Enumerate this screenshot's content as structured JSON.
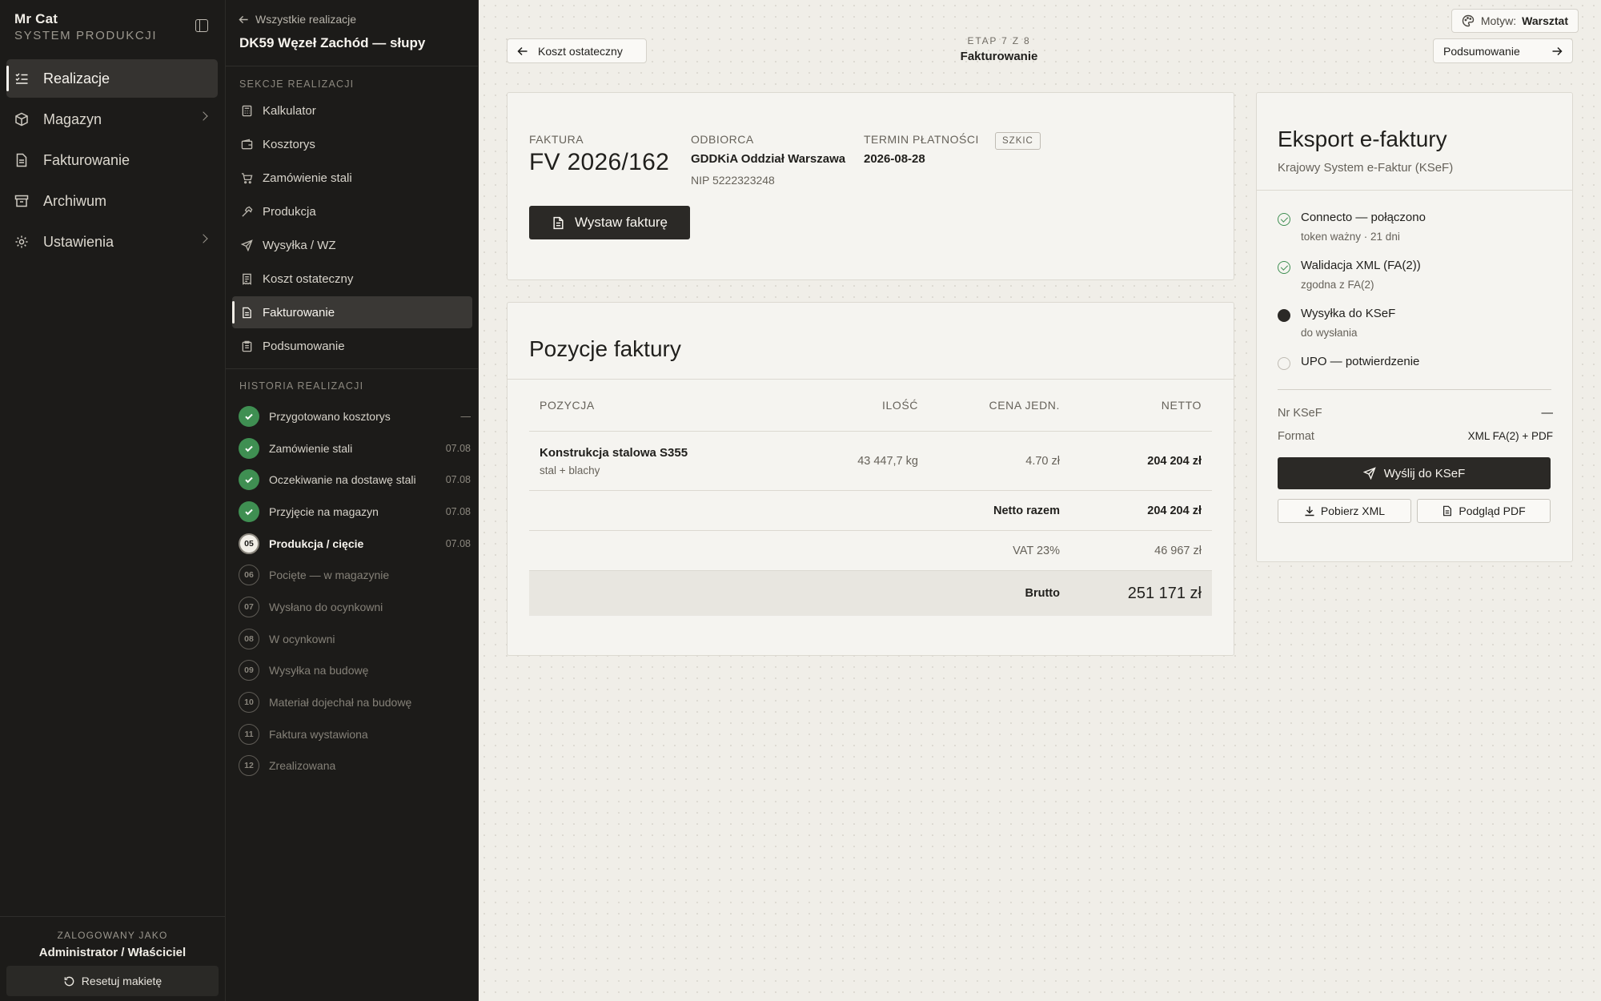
{
  "app": {
    "name": "Mr Cat",
    "subtitle": "SYSTEM PRODUKCJI"
  },
  "nav": [
    {
      "label": "Realizacje",
      "icon": "list-check-icon",
      "active": true
    },
    {
      "label": "Magazyn",
      "icon": "box-icon",
      "chevron": true
    },
    {
      "label": "Fakturowanie",
      "icon": "document-icon"
    },
    {
      "label": "Archiwum",
      "icon": "archive-icon"
    },
    {
      "label": "Ustawienia",
      "icon": "gear-icon",
      "chevron": true
    }
  ],
  "user": {
    "label": "ZALOGOWANY JAKO",
    "name": "Administrator / Właściciel",
    "reset_label": "Resetuj makietę"
  },
  "project": {
    "back_label": "Wszystkie realizacje",
    "title": "DK59 Węzeł Zachód — słupy",
    "sections_header": "SEKCJE REALIZACJI",
    "history_header": "HISTORIA REALIZACJI"
  },
  "sections": [
    {
      "label": "Kalkulator",
      "icon": "calculator-icon"
    },
    {
      "label": "Kosztorys",
      "icon": "wallet-icon"
    },
    {
      "label": "Zamówienie stali",
      "icon": "cart-icon"
    },
    {
      "label": "Produkcja",
      "icon": "hammer-icon"
    },
    {
      "label": "Wysyłka / WZ",
      "icon": "send-icon"
    },
    {
      "label": "Koszt ostateczny",
      "icon": "receipt-icon"
    },
    {
      "label": "Fakturowanie",
      "icon": "document-icon",
      "active": true
    },
    {
      "label": "Podsumowanie",
      "icon": "clipboard-icon"
    }
  ],
  "history": [
    {
      "num": "",
      "label": "Przygotowano kosztorys",
      "date": "—",
      "status": "done"
    },
    {
      "num": "",
      "label": "Zamówienie stali",
      "date": "07.08",
      "status": "done"
    },
    {
      "num": "",
      "label": "Oczekiwanie na dostawę stali",
      "date": "07.08",
      "status": "done"
    },
    {
      "num": "",
      "label": "Przyjęcie na magazyn",
      "date": "07.08",
      "status": "done"
    },
    {
      "num": "05",
      "label": "Produkcja / cięcie",
      "date": "07.08",
      "status": "current"
    },
    {
      "num": "06",
      "label": "Pocięte — w magazynie",
      "date": "",
      "status": "todo"
    },
    {
      "num": "07",
      "label": "Wysłano do ocynkowni",
      "date": "",
      "status": "todo"
    },
    {
      "num": "08",
      "label": "W ocynkowni",
      "date": "",
      "status": "todo"
    },
    {
      "num": "09",
      "label": "Wysyłka na budowę",
      "date": "",
      "status": "todo"
    },
    {
      "num": "10",
      "label": "Materiał dojechał na budowę",
      "date": "",
      "status": "todo"
    },
    {
      "num": "11",
      "label": "Faktura wystawiona",
      "date": "",
      "status": "todo"
    },
    {
      "num": "12",
      "label": "Zrealizowana",
      "date": "",
      "status": "todo"
    }
  ],
  "topbar": {
    "theme_label": "Motyw:",
    "theme_value": "Warsztat",
    "prev_label": "Koszt ostateczny",
    "next_label": "Podsumowanie",
    "step_label": "ETAP 7 Z 8",
    "step_title": "Fakturowanie"
  },
  "invoice": {
    "number_label": "FAKTURA",
    "number": "FV 2026/162",
    "recipient_label": "ODBIORCA",
    "recipient": "GDDKiA Oddział Warszawa",
    "nip": "NIP 5222323248",
    "due_label": "TERMIN PŁATNOŚCI",
    "due": "2026-08-28",
    "status": "SZKIC",
    "issue_button": "Wystaw fakturę"
  },
  "items": {
    "title": "Pozycje faktury",
    "headers": [
      "POZYCJA",
      "ILOŚĆ",
      "CENA JEDN.",
      "NETTO"
    ],
    "rows": [
      {
        "name": "Konstrukcja stalowa S355",
        "desc": "stal + blachy",
        "qty": "43 447,7 kg",
        "price": "4.70 zł",
        "net": "204 204 zł"
      }
    ],
    "net_total_label": "Netto razem",
    "net_total": "204 204 zł",
    "vat_label": "VAT 23%",
    "vat": "46 967 zł",
    "gross_label": "Brutto",
    "gross": "251 171 zł"
  },
  "ksef": {
    "title": "Eksport e-faktury",
    "subtitle": "Krajowy System e-Faktur (KSeF)",
    "steps": [
      {
        "title": "Connecto — połączono",
        "sub": "token ważny · 21 dni",
        "status": "ok"
      },
      {
        "title": "Walidacja XML (FA(2))",
        "sub": "zgodna z FA(2)",
        "status": "ok"
      },
      {
        "title": "Wysyłka do KSeF",
        "sub": "do wysłania",
        "status": "cur"
      },
      {
        "title": "UPO — potwierdzenie",
        "sub": "",
        "status": "todo"
      }
    ],
    "nr_label": "Nr KSeF",
    "nr_value": "—",
    "format_label": "Format",
    "format_value": "XML FA(2) + PDF",
    "send_button": "Wyślij do KSeF",
    "xml_button": "Pobierz XML",
    "pdf_button": "Podgląd PDF"
  },
  "colors": {
    "sidebar_bg": "#1c1b19",
    "accent_dark": "#2b2926",
    "success": "#3f8f52",
    "page_bg": "#f0eee8"
  }
}
